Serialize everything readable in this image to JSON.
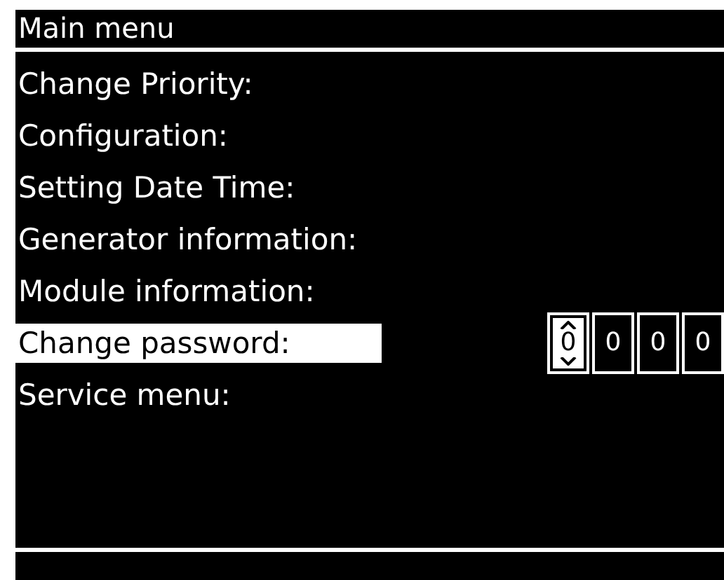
{
  "title": "Main menu",
  "items": [
    {
      "label": "Change Priority:",
      "selected": false
    },
    {
      "label": "Configuration:",
      "selected": false
    },
    {
      "label": "Setting Date Time:",
      "selected": false
    },
    {
      "label": "Generator information:",
      "selected": false
    },
    {
      "label": "Module information:",
      "selected": false
    },
    {
      "label": "Change password:",
      "selected": true,
      "digits": [
        {
          "value": "0",
          "selected": true
        },
        {
          "value": "0",
          "selected": false
        },
        {
          "value": "0",
          "selected": false
        },
        {
          "value": "0",
          "selected": false
        }
      ]
    },
    {
      "label": "Service menu:",
      "selected": false
    }
  ]
}
